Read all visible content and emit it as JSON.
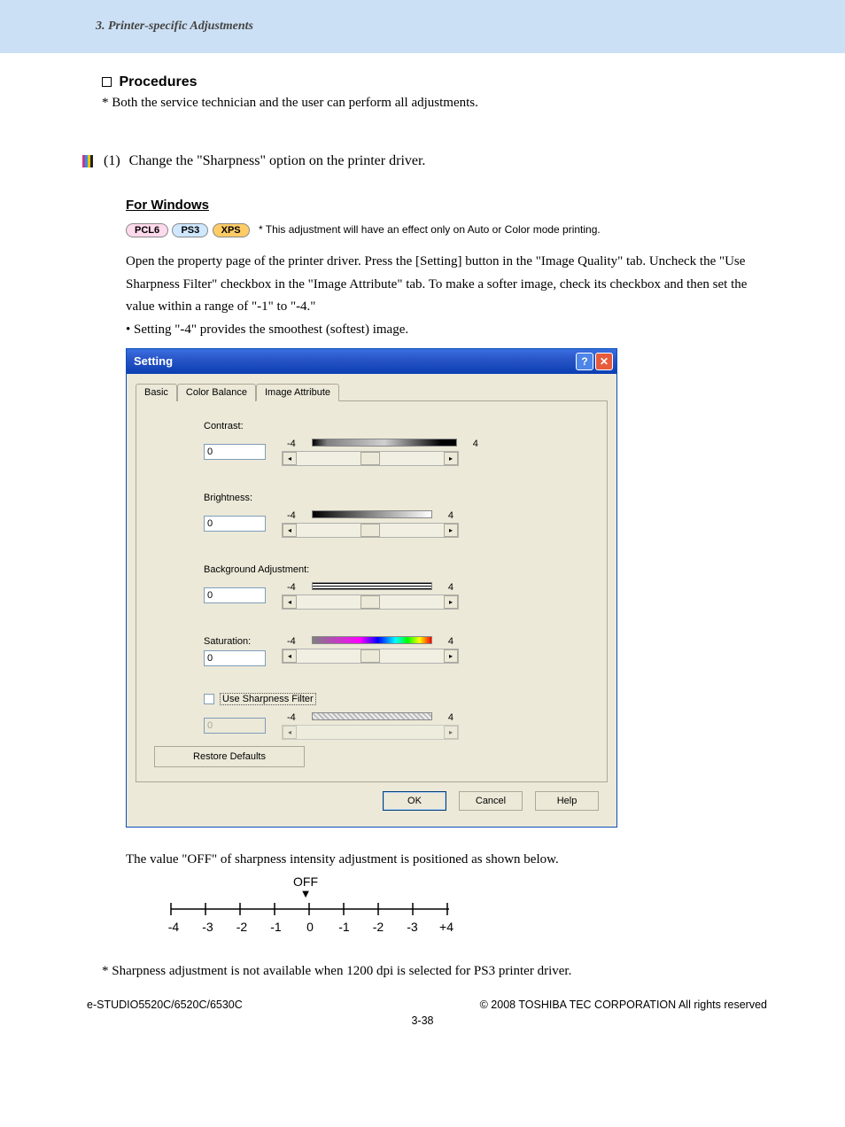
{
  "header": {
    "chapter": "3. Printer-specific Adjustments"
  },
  "section": {
    "procedures_heading": "Procedures",
    "note_both": "Both the service technician and the user can perform all adjustments.",
    "step1_num": "(1)",
    "step1_text": "Change the \"Sharpness\" option on the printer driver.",
    "for_windows": "For Windows",
    "pills": {
      "pcl6": "PCL6",
      "ps3": "PS3",
      "xps": "XPS"
    },
    "pill_note": "* This adjustment will have an effect only on Auto or Color mode printing.",
    "para": "Open the property page of the printer driver. Press the [Setting] button in the \"Image Quality\" tab. Uncheck the \"Use Sharpness Filter\" checkbox in the \"Image Attribute\" tab. To make a softer image, check its checkbox and then set the value within a range of \"-1\" to \"-4.\"",
    "bullet": "• Setting \"-4\" provides the smoothest (softest) image.",
    "after_para": "The value \"OFF\" of sharpness intensity adjustment is positioned as shown below.",
    "foot_note": "Sharpness adjustment is not available when 1200 dpi is selected for PS3 printer driver."
  },
  "dialog": {
    "title": "Setting",
    "tabs": {
      "basic": "Basic",
      "color_balance": "Color Balance",
      "image_attribute": "Image Attribute"
    },
    "labels": {
      "contrast": "Contrast:",
      "brightness": "Brightness:",
      "bgadjust": "Background Adjustment:",
      "saturation": "Saturation:",
      "sharpness_chk": "Use Sharpness Filter",
      "min": "-4",
      "max": "4",
      "restore": "Restore Defaults",
      "ok": "OK",
      "cancel": "Cancel",
      "help": "Help"
    },
    "values": {
      "contrast": "0",
      "brightness": "0",
      "bgadjust": "0",
      "saturation": "0",
      "sharpness": "0"
    }
  },
  "axis": {
    "off_label": "OFF",
    "ticks": [
      "-4",
      "-3",
      "-2",
      "-1",
      "0",
      "-1",
      "-2",
      "-3",
      "+4"
    ]
  },
  "footer": {
    "left": "e-STUDIO5520C/6520C/6530C",
    "right": "© 2008 TOSHIBA TEC CORPORATION All rights reserved",
    "page": "3-38"
  }
}
